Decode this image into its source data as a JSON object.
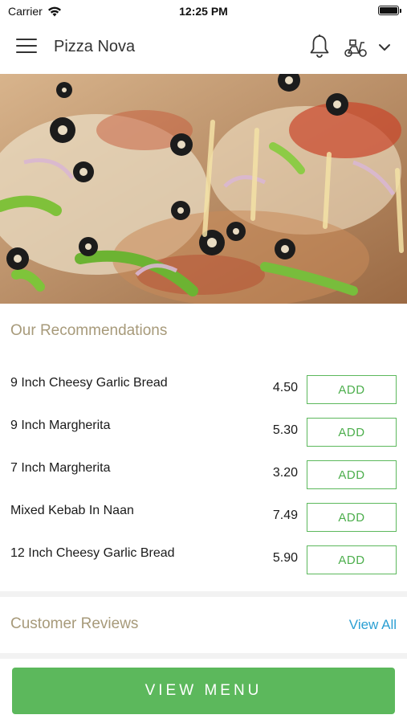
{
  "status_bar": {
    "carrier": "Carrier",
    "time": "12:25 PM"
  },
  "header": {
    "title": "Pizza Nova",
    "icons": [
      "menu-icon",
      "bell-icon",
      "delivery-scooter-icon",
      "chevron-down-icon"
    ]
  },
  "recommendations": {
    "heading": "Our Recommendations",
    "items": [
      {
        "name": "9 Inch Cheesy Garlic Bread",
        "price": "4.50",
        "button": "ADD"
      },
      {
        "name": "9 Inch Margherita",
        "price": "5.30",
        "button": "ADD"
      },
      {
        "name": "7 Inch Margherita",
        "price": "3.20",
        "button": "ADD"
      },
      {
        "name": "Mixed Kebab In Naan",
        "price": "7.49",
        "button": "ADD"
      },
      {
        "name": "12 Inch Cheesy Garlic Bread",
        "price": "5.90",
        "button": "ADD"
      }
    ]
  },
  "reviews": {
    "heading": "Customer Reviews",
    "view_all": "View All"
  },
  "footer": {
    "view_menu": "VIEW MENU"
  },
  "colors": {
    "accent_green": "#5cb85c",
    "heading_tan": "#a79a7a",
    "link_blue": "#2b9fd3"
  }
}
